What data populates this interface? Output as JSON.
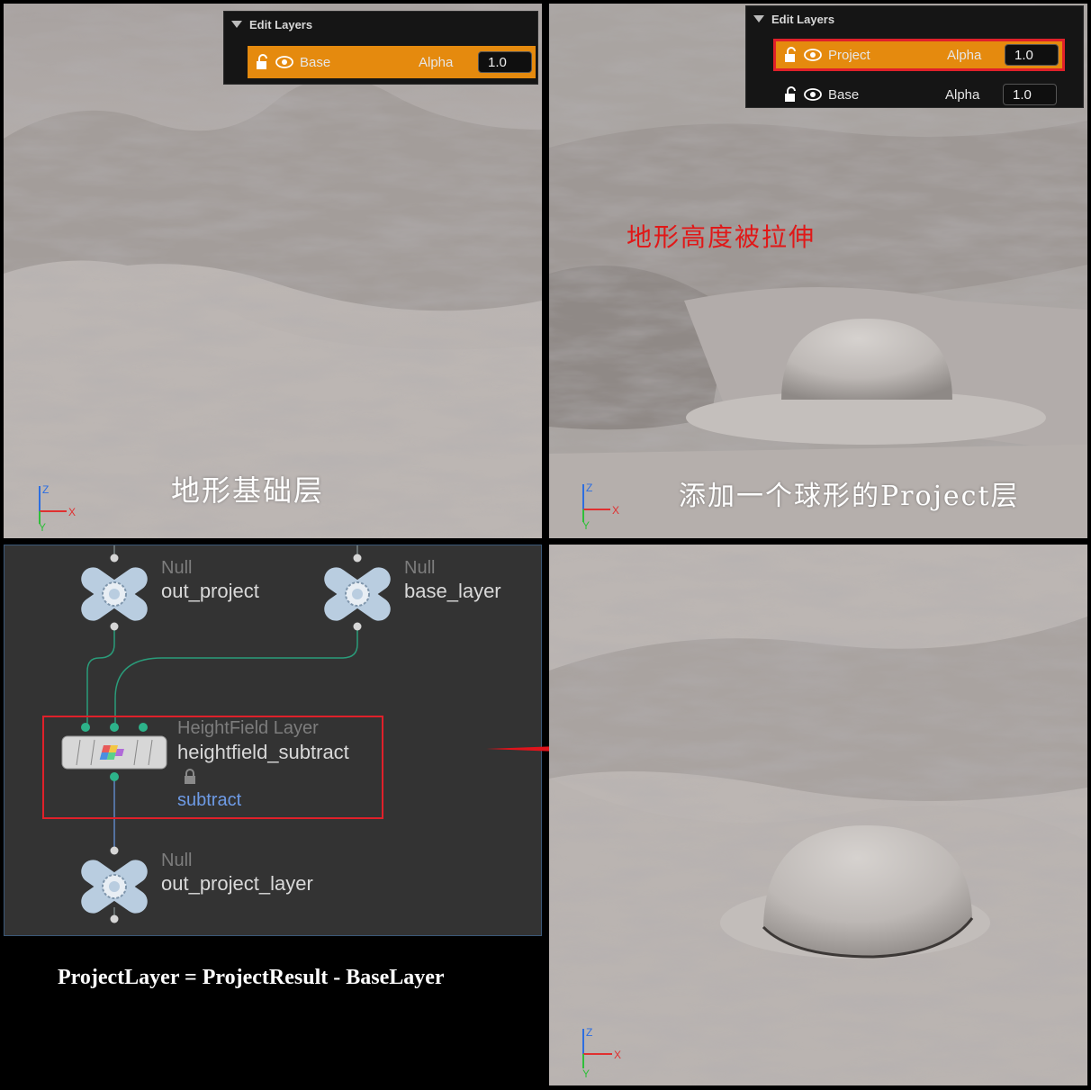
{
  "top_left": {
    "edit_layers": {
      "title": "Edit Layers",
      "rows": [
        {
          "name": "Base",
          "alpha_label": "Alpha",
          "alpha_value": "1.0",
          "selected": true
        }
      ]
    },
    "caption": "地形基础层",
    "axis": {
      "z": "Z",
      "x": "X",
      "y": "Y"
    }
  },
  "top_right": {
    "edit_layers": {
      "title": "Edit Layers",
      "rows": [
        {
          "name": "Project",
          "alpha_label": "Alpha",
          "alpha_value": "1.0",
          "selected": true
        },
        {
          "name": "Base",
          "alpha_label": "Alpha",
          "alpha_value": "1.0",
          "selected": false
        }
      ]
    },
    "annotation": "地形高度被拉伸",
    "caption": "添加一个球形的Project层",
    "axis": {
      "z": "Z",
      "x": "X",
      "y": "Y"
    }
  },
  "graph": {
    "nodes": {
      "out_project": {
        "type": "Null",
        "name": "out_project"
      },
      "base_layer": {
        "type": "Null",
        "name": "base_layer"
      },
      "heightfield_subtract": {
        "type": "HeightField Layer",
        "name": "heightfield_subtract",
        "mode": "subtract"
      },
      "out_project_layer": {
        "type": "Null",
        "name": "out_project_layer"
      }
    }
  },
  "formula": "ProjectLayer = ProjectResult - BaseLayer",
  "bottom_right": {
    "axis": {
      "z": "Z",
      "x": "X",
      "y": "Y"
    }
  },
  "colors": {
    "selected_layer": "#e58a0e",
    "highlight_box": "#e0202a",
    "annotation_text": "#e01818",
    "wire": "#2a9c7a",
    "node_body": "#b9cde0"
  }
}
